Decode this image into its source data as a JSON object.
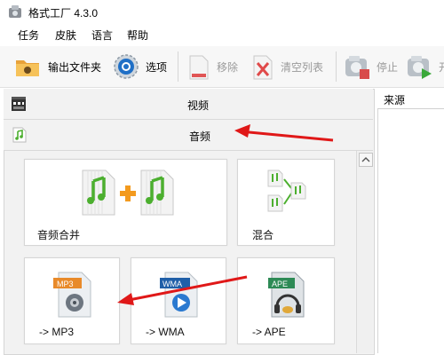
{
  "window": {
    "title": "格式工厂 4.3.0"
  },
  "menu": {
    "items": [
      "任务",
      "皮肤",
      "语言",
      "帮助"
    ]
  },
  "toolbar": {
    "output_folder": "输出文件夹",
    "options": "选项",
    "remove": "移除",
    "clear_list": "清空列表",
    "stop": "停止",
    "start": "开"
  },
  "categories": {
    "video": "视频",
    "audio": "音频"
  },
  "tiles": {
    "audio_merge": "音频合并",
    "mix": "混合",
    "to_mp3": "-> MP3",
    "to_wma": "-> WMA",
    "to_ape": "-> APE"
  },
  "file_badges": {
    "mp3": "MP3",
    "wma": "WMA",
    "ape": "APE"
  },
  "list": {
    "source_header": "来源"
  },
  "colors": {
    "accent_green": "#4caf2f",
    "arrow_red": "#e01818",
    "plus_orange": "#f39a1e"
  }
}
